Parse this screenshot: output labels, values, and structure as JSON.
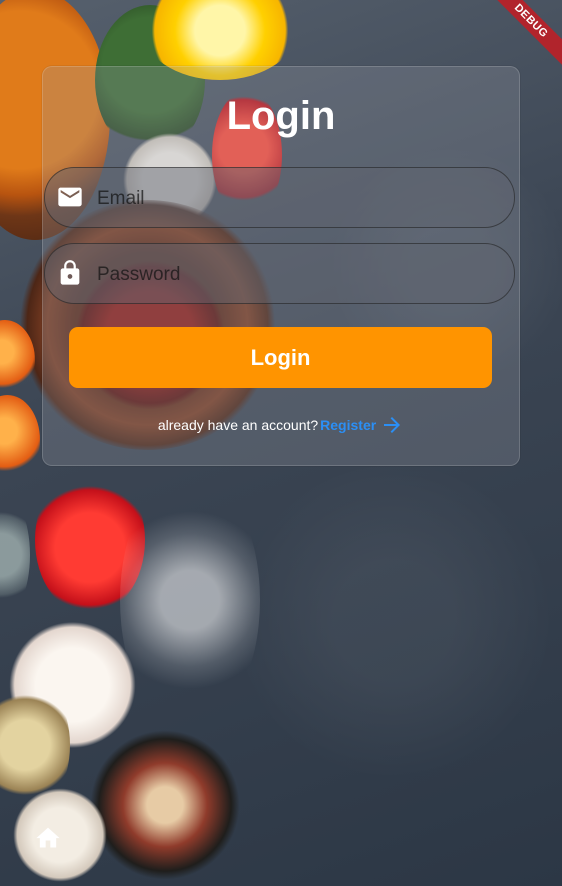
{
  "debug_banner": "DEBUG",
  "title": "Login",
  "email": {
    "placeholder": "Email",
    "value": "",
    "icon": "mail-icon"
  },
  "password": {
    "placeholder": "Password",
    "value": "",
    "icon": "lock-icon"
  },
  "login_button": "Login",
  "register_prompt": "already have an account?",
  "register_link": "Register",
  "colors": {
    "primary": "#ff9400",
    "link": "#2b8ff5",
    "debug_banner": "#b1242c",
    "text": "#ffffff"
  },
  "bottom_icon": "home-icon"
}
